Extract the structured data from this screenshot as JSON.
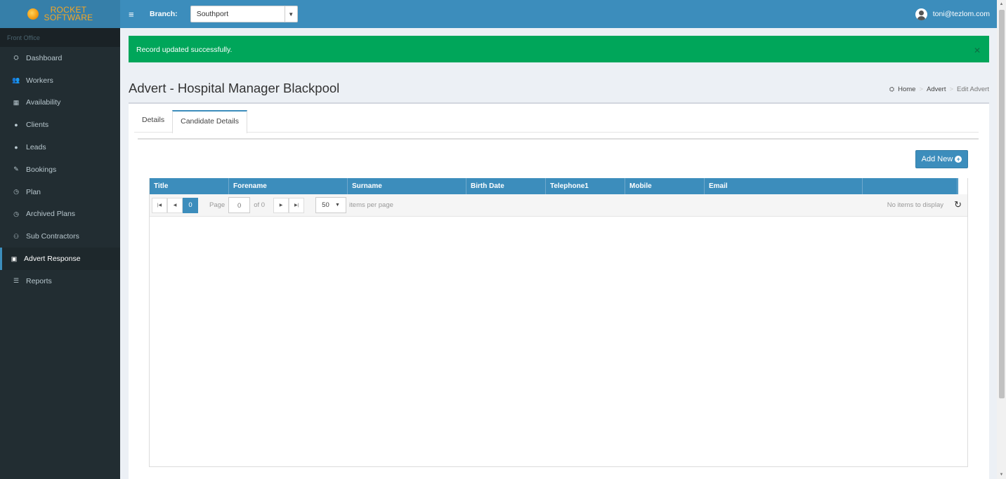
{
  "logo": {
    "line1": "ROCKET",
    "line2": "SOFTWARE"
  },
  "sidebar": {
    "section_header": "Front Office",
    "items": [
      {
        "label": "Dashboard",
        "icon": "dashboard-icon",
        "glyph": "⛭"
      },
      {
        "label": "Workers",
        "icon": "users-icon",
        "glyph": "👥"
      },
      {
        "label": "Availability",
        "icon": "calendar-icon",
        "glyph": "▦"
      },
      {
        "label": "Clients",
        "icon": "user-icon",
        "glyph": "●"
      },
      {
        "label": "Leads",
        "icon": "user-plus-icon",
        "glyph": "●"
      },
      {
        "label": "Bookings",
        "icon": "edit-icon",
        "glyph": "✎"
      },
      {
        "label": "Plan",
        "icon": "clock-icon",
        "glyph": "◷"
      },
      {
        "label": "Archived Plans",
        "icon": "clock-icon",
        "glyph": "◷"
      },
      {
        "label": "Sub Contractors",
        "icon": "handshake-icon",
        "glyph": "⚇"
      },
      {
        "label": "Advert Response",
        "icon": "list-alt-icon",
        "glyph": "▣",
        "active": true
      },
      {
        "label": "Reports",
        "icon": "list-icon",
        "glyph": "☰"
      }
    ]
  },
  "header": {
    "menu_glyph": "≡",
    "branch_label": "Branch:",
    "branch_value": "Southport",
    "user_email": "toni@tezlom.com"
  },
  "alert": {
    "message": "Record updated successfully.",
    "close_glyph": "✕"
  },
  "page": {
    "title": "Advert - Hospital Manager Blackpool",
    "breadcrumb": {
      "home": "Home",
      "parent": "Advert",
      "current": "Edit Advert",
      "sep": ">"
    }
  },
  "tabs": [
    {
      "label": "Details",
      "active": false
    },
    {
      "label": "Candidate Details",
      "active": true
    }
  ],
  "add_button": {
    "label": "Add New",
    "glyph": "+"
  },
  "grid": {
    "columns": [
      "Title",
      "Forename",
      "Surname",
      "Birth Date",
      "Telephone1",
      "Mobile",
      "Email",
      ""
    ],
    "pager": {
      "current_page": "0",
      "page_label": "Page",
      "page_input": "0",
      "of_label": "of 0",
      "page_size": "50",
      "items_per_page_label": "items per page",
      "info": "No items to display"
    }
  },
  "colors": {
    "primary": "#3c8dbc",
    "sidebar_bg": "#222d32",
    "success": "#00a65a"
  }
}
